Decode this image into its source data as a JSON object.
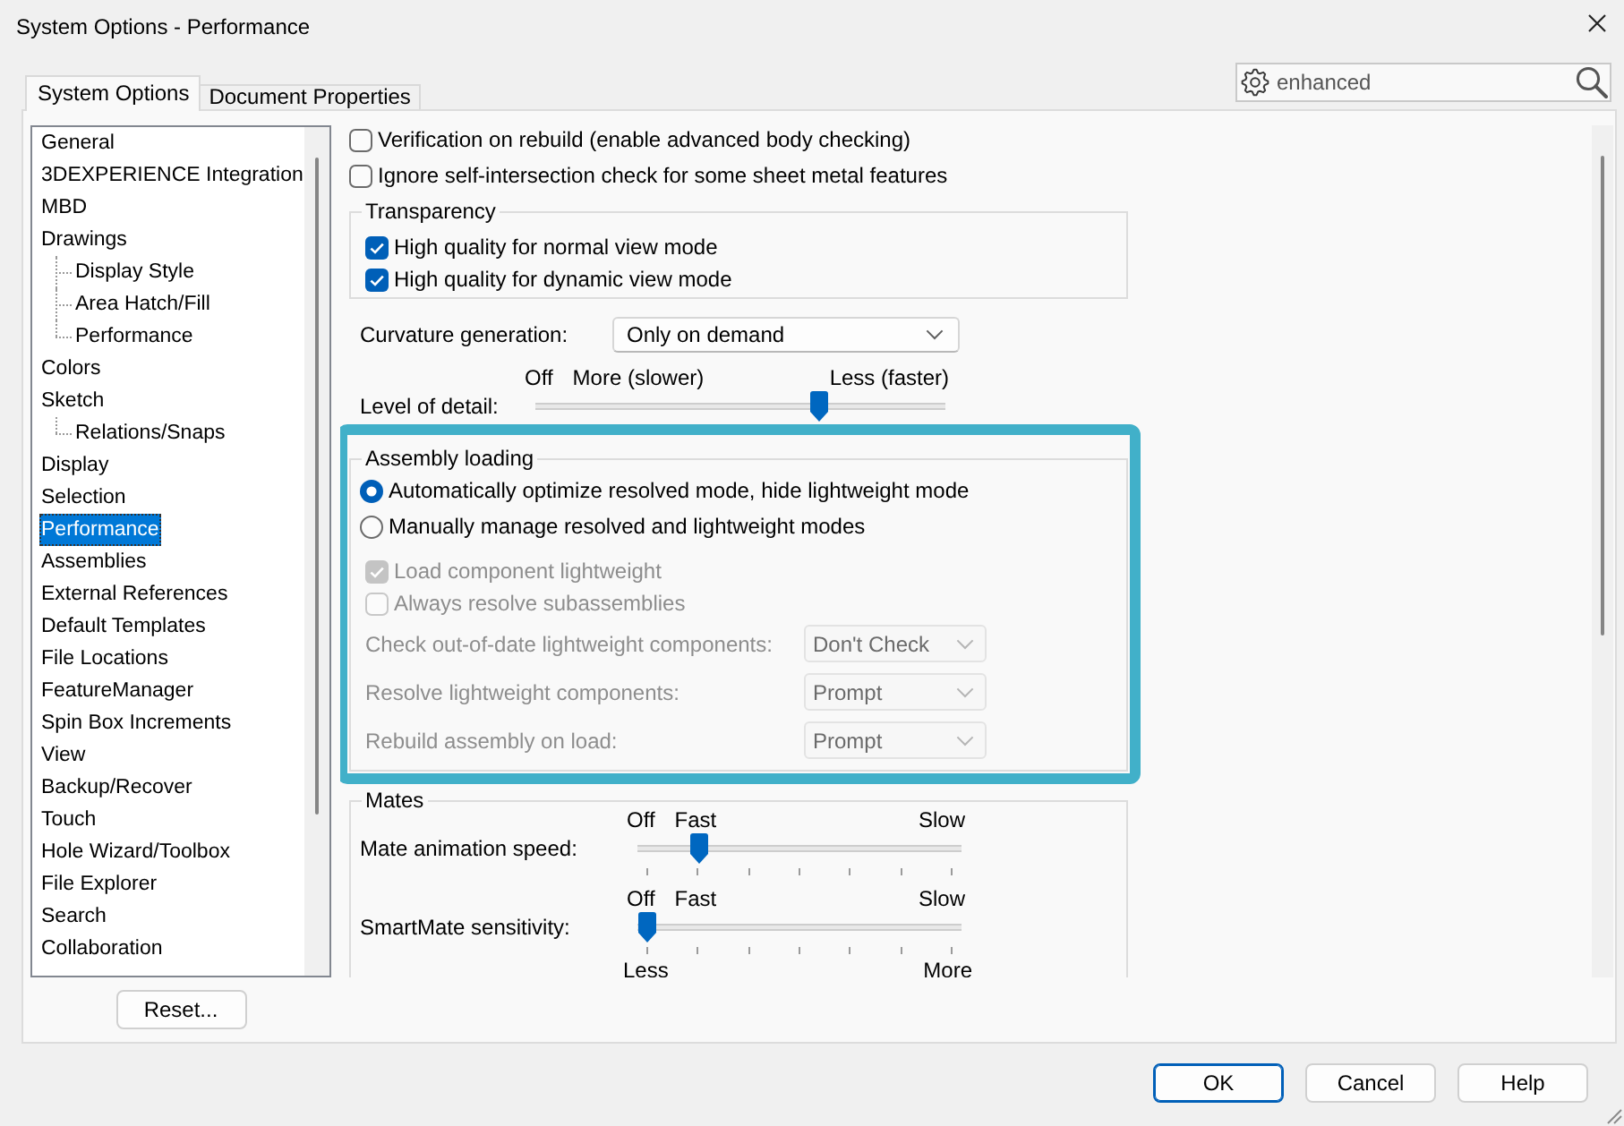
{
  "window": {
    "title": "System Options - Performance"
  },
  "tabs": [
    {
      "label": "System Options",
      "selected": true
    },
    {
      "label": "Document Properties",
      "selected": false
    }
  ],
  "search": {
    "value": "enhanced"
  },
  "tree": [
    {
      "label": "General",
      "selected": false
    },
    {
      "label": "3DEXPERIENCE Integration",
      "selected": false
    },
    {
      "label": "MBD",
      "selected": false
    },
    {
      "label": "Drawings",
      "selected": false,
      "children": [
        {
          "label": "Display Style",
          "selected": false
        },
        {
          "label": "Area Hatch/Fill",
          "selected": false
        },
        {
          "label": "Performance",
          "selected": false
        }
      ]
    },
    {
      "label": "Colors",
      "selected": false
    },
    {
      "label": "Sketch",
      "selected": false,
      "children": [
        {
          "label": "Relations/Snaps",
          "selected": false
        }
      ]
    },
    {
      "label": "Display",
      "selected": false
    },
    {
      "label": "Selection",
      "selected": false
    },
    {
      "label": "Performance",
      "selected": true
    },
    {
      "label": "Assemblies",
      "selected": false
    },
    {
      "label": "External References",
      "selected": false
    },
    {
      "label": "Default Templates",
      "selected": false
    },
    {
      "label": "File Locations",
      "selected": false
    },
    {
      "label": "FeatureManager",
      "selected": false
    },
    {
      "label": "Spin Box Increments",
      "selected": false
    },
    {
      "label": "View",
      "selected": false
    },
    {
      "label": "Backup/Recover",
      "selected": false
    },
    {
      "label": "Touch",
      "selected": false
    },
    {
      "label": "Hole Wizard/Toolbox",
      "selected": false
    },
    {
      "label": "File Explorer",
      "selected": false
    },
    {
      "label": "Search",
      "selected": false
    },
    {
      "label": "Collaboration",
      "selected": false
    }
  ],
  "reset_button": "Reset...",
  "options": [
    {
      "kind": "checkbox",
      "label": "Verification on rebuild (enable advanced body checking)",
      "checked": false,
      "disabled": false
    },
    {
      "kind": "checkbox",
      "label": "Ignore self-intersection check for some sheet metal features",
      "checked": false,
      "disabled": false
    },
    {
      "kind": "group",
      "title": "Transparency",
      "highlighted": false,
      "items": [
        {
          "kind": "checkbox",
          "label": "High quality for normal view mode",
          "checked": true,
          "disabled": false
        },
        {
          "kind": "checkbox",
          "label": "High quality for dynamic view mode",
          "checked": true,
          "disabled": false
        }
      ]
    },
    {
      "kind": "dropdown",
      "label": "Curvature generation:",
      "value": "Only on demand",
      "disabled": false
    },
    {
      "kind": "slider",
      "label": "Level of detail:",
      "ticks": false,
      "top_labels": [
        "Off",
        "More (slower)",
        "Less (faster)"
      ],
      "level": 0.7
    },
    {
      "kind": "group",
      "title": "Assembly loading",
      "highlighted": true,
      "items": [
        {
          "kind": "radio",
          "label": "Automatically optimize resolved mode, hide lightweight mode",
          "selected": true,
          "disabled": false
        },
        {
          "kind": "radio",
          "label": "Manually manage resolved and lightweight modes",
          "selected": false,
          "disabled": false
        },
        {
          "kind": "checkbox",
          "label": "Load component lightweight",
          "checked": true,
          "disabled": true
        },
        {
          "kind": "checkbox",
          "label": "Always resolve subassemblies",
          "checked": false,
          "disabled": true
        },
        {
          "kind": "dropdown",
          "label": "Check out-of-date lightweight components:",
          "value": "Don't Check",
          "disabled": true
        },
        {
          "kind": "dropdown",
          "label": "Resolve lightweight components:",
          "value": "Prompt",
          "disabled": true
        },
        {
          "kind": "dropdown",
          "label": "Rebuild assembly on load:",
          "value": "Prompt",
          "disabled": true
        }
      ]
    },
    {
      "kind": "group",
      "title": "Mates",
      "highlighted": false,
      "items": [
        {
          "kind": "slider",
          "label": "Mate animation speed:",
          "ticks": true,
          "top_labels": [
            "Off",
            "Fast",
            "Slow"
          ],
          "level": 0.17
        },
        {
          "kind": "slider",
          "label": "SmartMate sensitivity:",
          "ticks": true,
          "top_labels": [
            "Off",
            "Fast",
            "Slow"
          ],
          "bottom_labels": [
            "Less",
            "More"
          ],
          "level": 0
        }
      ]
    }
  ],
  "buttons": [
    {
      "label": "OK",
      "default": true
    },
    {
      "label": "Cancel",
      "default": false
    },
    {
      "label": "Help",
      "default": false
    }
  ]
}
